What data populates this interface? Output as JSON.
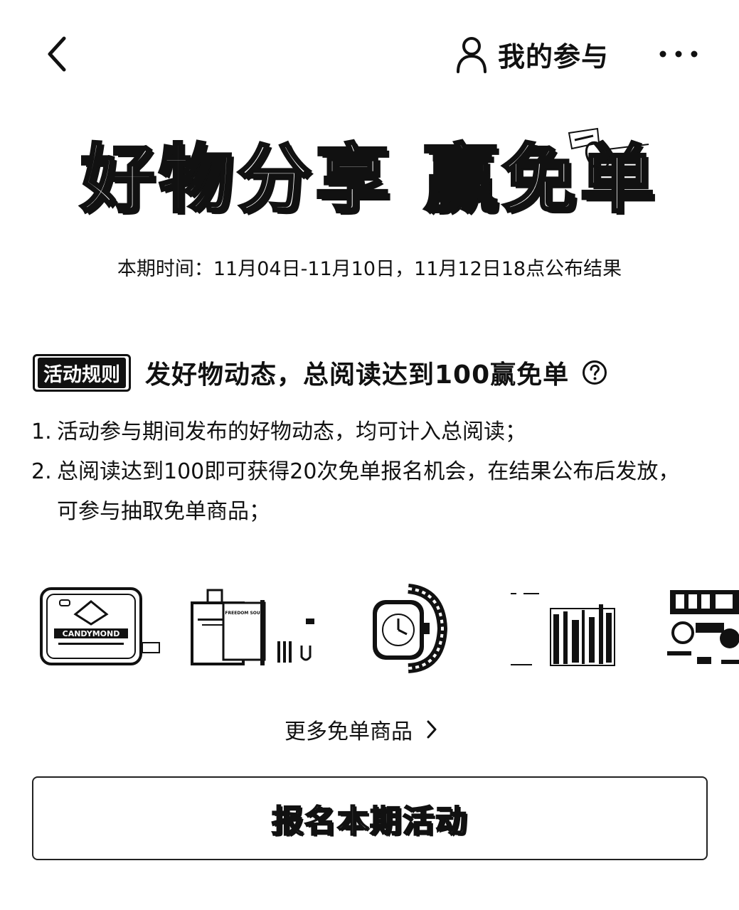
{
  "header": {
    "back_icon": "chevron-left-icon",
    "my_participation_icon": "user-icon",
    "my_participation_label": "我的参与",
    "more_icon": "more-dots-icon"
  },
  "hero": {
    "title": "好物分享 赢免单",
    "period": "本期时间：11月04日-11月10日，11月12日18点公布结果"
  },
  "rules": {
    "tag": "活动规则",
    "headline": "发好物动态，总阅读达到100赢免单",
    "help_icon": "question-circle-icon",
    "items": [
      {
        "num": "1.",
        "text": "活动参与期间发布的好物动态，均可计入总阅读；"
      },
      {
        "num": "2.",
        "text": "总阅读达到100即可获得20次免单报名机会，在结果公布后发放，可参与抽取免单商品；"
      }
    ]
  },
  "products": {
    "items": [
      {
        "name": "candy-tin",
        "label": "CANDYMOND"
      },
      {
        "name": "perfume",
        "label": "FREEDOM SOUL"
      },
      {
        "name": "smart-watch",
        "label": ""
      },
      {
        "name": "snack-pack",
        "label": ""
      },
      {
        "name": "food-box",
        "label": ""
      }
    ]
  },
  "more_link": {
    "label": "更多免单商品",
    "icon": "chevron-right-icon"
  },
  "signup_button": {
    "label": "报名本期活动"
  }
}
